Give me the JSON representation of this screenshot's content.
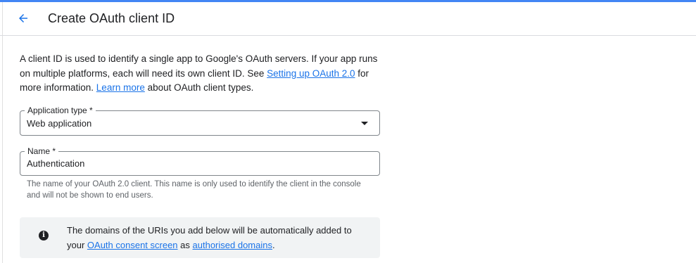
{
  "colors": {
    "accent": "#4285f4",
    "link": "#1a73e8",
    "hint": "#5f6368",
    "info_bg": "#f1f3f4"
  },
  "header": {
    "back_icon": "arrow-back-icon",
    "title": "Create OAuth client ID"
  },
  "intro": {
    "text_1": "A client ID is used to identify a single app to Google's OAuth servers. If your app runs on multiple platforms, each will need its own client ID. See ",
    "link_1": "Setting up OAuth 2.0",
    "text_2": " for more information. ",
    "link_2": "Learn more",
    "text_3": " about OAuth client types."
  },
  "application_type": {
    "label": "Application type *",
    "value": "Web application",
    "icon": "dropdown-arrow-icon"
  },
  "name_field": {
    "label": "Name *",
    "value": "Authentication",
    "hint": "The name of your OAuth 2.0 client. This name is only used to identify the client in the console and will not be shown to end users."
  },
  "info": {
    "icon": "info-icon",
    "text_1": "The domains of the URIs you add below will be automatically added to your ",
    "link_1": "OAuth consent screen",
    "text_2": " as ",
    "link_2": "authorised domains",
    "text_3": "."
  }
}
